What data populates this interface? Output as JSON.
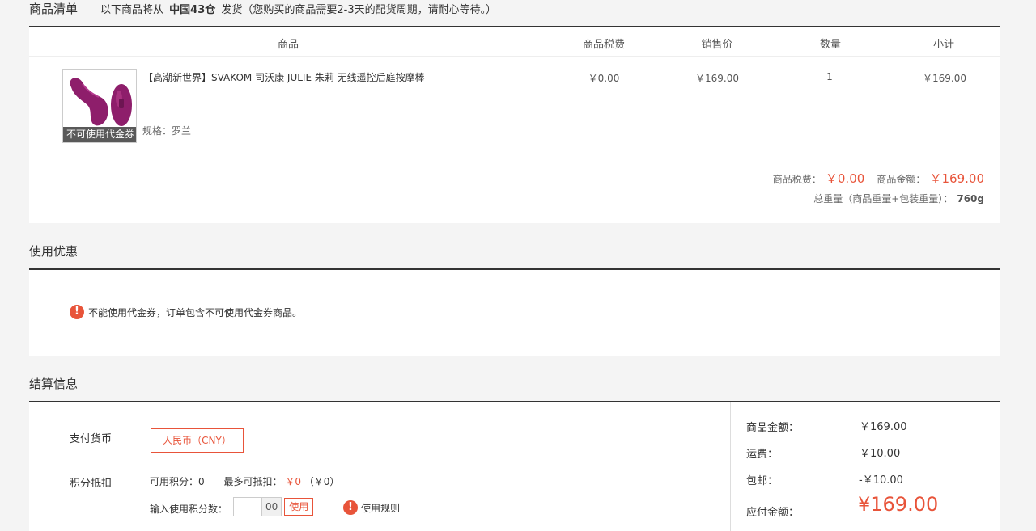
{
  "order_list": {
    "title": "商品清单",
    "note_prefix": "以下商品将从",
    "warehouse": "中国43仓",
    "note_suffix": "发货（您购买的商品需要2-3天的配货周期，请耐心等待。）",
    "columns": [
      "商品",
      "商品税费",
      "销售价",
      "数量",
      "小计"
    ],
    "items": [
      {
        "name": "【高潮新世界】SVAKOM 司沃康 JULIE 朱莉 无线遥控后庭按摩棒",
        "spec": "规格：罗兰",
        "badge": "不可使用代金券",
        "tax": "￥0.00",
        "price": "￥169.00",
        "qty": "1",
        "subtotal": "￥169.00"
      }
    ],
    "summary": {
      "tax_label": "商品税费：",
      "tax_value": "￥0.00",
      "amount_label": "商品金额：",
      "amount_value": "￥169.00",
      "weight_label": "总重量（商品重量+包装重量）：",
      "weight_value": "760g"
    }
  },
  "discount": {
    "title": "使用优惠",
    "message": "不能使用代金券，订单包含不可使用代金券商品。"
  },
  "settlement": {
    "title": "结算信息",
    "currency_label": "支付货币",
    "currency_value": "人民币（CNY）",
    "points_label": "积分抵扣",
    "available_points": "可用积分：0",
    "max_deduct_label": "最多可抵扣：",
    "max_deduct_value": "￥0",
    "max_deduct_paren": "（￥0）",
    "input_label": "输入使用积分数：",
    "input_suffix": "00",
    "use_button": "使用",
    "rules_link": "使用规则",
    "totals": {
      "goods_label": "商品金额：",
      "goods_value": "￥169.00",
      "shipping_label": "运费：",
      "shipping_value": "￥10.00",
      "free_ship_label": "包邮：",
      "free_ship_value": "-￥10.00",
      "payable_label": "应付金额：",
      "payable_value": "¥169.00"
    }
  },
  "colors": {
    "accent": "#e8543a",
    "product": "#8e1e6b"
  }
}
